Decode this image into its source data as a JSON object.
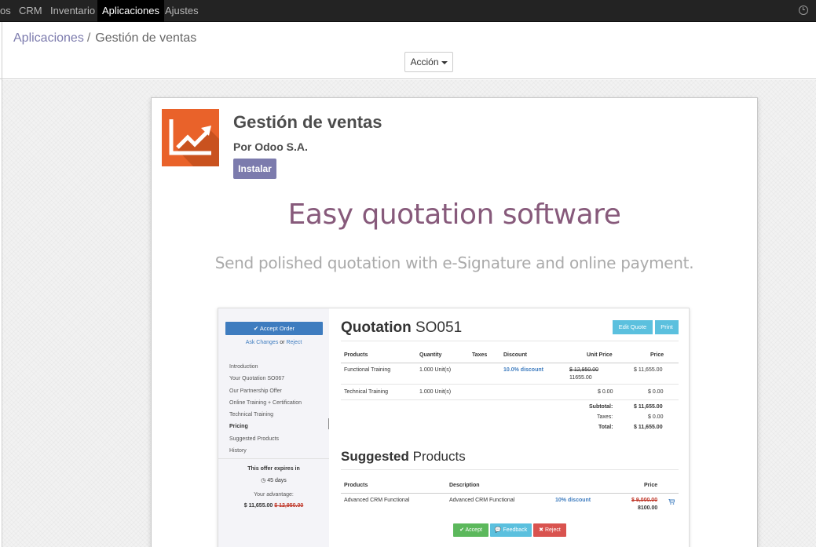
{
  "topnav": {
    "items": [
      {
        "label": "os",
        "active": false
      },
      {
        "label": "CRM",
        "active": false
      },
      {
        "label": "Inventario",
        "active": false
      },
      {
        "label": "Aplicaciones",
        "active": true
      },
      {
        "label": "Ajustes",
        "active": false
      }
    ],
    "clock_icon": "clock-icon"
  },
  "breadcrumb": {
    "parent": "Aplicaciones",
    "separator": "/",
    "current": "Gestión de ventas"
  },
  "action_button": {
    "label": "Acción"
  },
  "app": {
    "title": "Gestión de ventas",
    "author": "Por Odoo S.A.",
    "install_label": "Instalar",
    "icon": "sales-chart-icon",
    "icon_color": "#e9622a"
  },
  "description": {
    "headline": "Easy quotation software",
    "subline": "Send polished quotation with e-Signature and online payment."
  },
  "mock": {
    "accept_order": "✔ Accept Order",
    "ask_changes": "Ask Changes",
    "or": "or",
    "reject_link": "Reject",
    "menu": [
      "Introduction",
      "Your Quotation SO067",
      "Our Partnership Offer",
      "Online Training + Certification",
      "Technical Training",
      "Pricing",
      "Suggested Products",
      "History"
    ],
    "active_menu_index": 5,
    "expires_label": "This offer expires in",
    "expires_days": "◷ 45 days",
    "advantage_label": "Your advantage:",
    "advantage_price": "$ 11,655.00",
    "advantage_old_price": "$ 12,950.00",
    "quotation_word": "Quotation",
    "quotation_number": "SO051",
    "edit_quote": "Edit Quote",
    "print": "Print",
    "table_headers": [
      "Products",
      "Quantity",
      "Taxes",
      "Discount",
      "Unit Price",
      "Price"
    ],
    "lines": [
      {
        "product": "Functional Training",
        "quantity": "1.000 Unit(s)",
        "discount": "10.0% discount",
        "unit_price_old": "$ 12,950.00",
        "unit_price": "11655.00",
        "price": "$ 11,655.00"
      },
      {
        "product": "Technical Training",
        "quantity": "1.000 Unit(s)",
        "discount": "",
        "unit_price_old": "",
        "unit_price": "$ 0.00",
        "price": "$ 0.00"
      }
    ],
    "totals": [
      {
        "label": "Subtotal:",
        "value": "$ 11,655.00"
      },
      {
        "label": "Taxes:",
        "value": "$ 0.00"
      },
      {
        "label": "Total:",
        "value": "$ 11,655.00"
      }
    ],
    "suggested_word": "Suggested",
    "products_word": "Products",
    "sugg_headers": [
      "Products",
      "Description",
      "Price"
    ],
    "sugg_line": {
      "product": "Advanced CRM Functional",
      "description": "Advanced CRM Functional",
      "discount": "10% discount",
      "old_price": "$ 9,000.00",
      "price": "8100.00"
    },
    "buttons": {
      "accept": "✔ Accept",
      "feedback": "💬 Feedback",
      "reject": "✖ Reject"
    },
    "colors": {
      "primary": "#3e7cbf",
      "info": "#5bc0de",
      "success": "#5cb85c",
      "danger": "#d9534f"
    }
  },
  "colors": {
    "brand": "#7c7bad",
    "headline": "#875a7b",
    "topbar": "#232323"
  }
}
